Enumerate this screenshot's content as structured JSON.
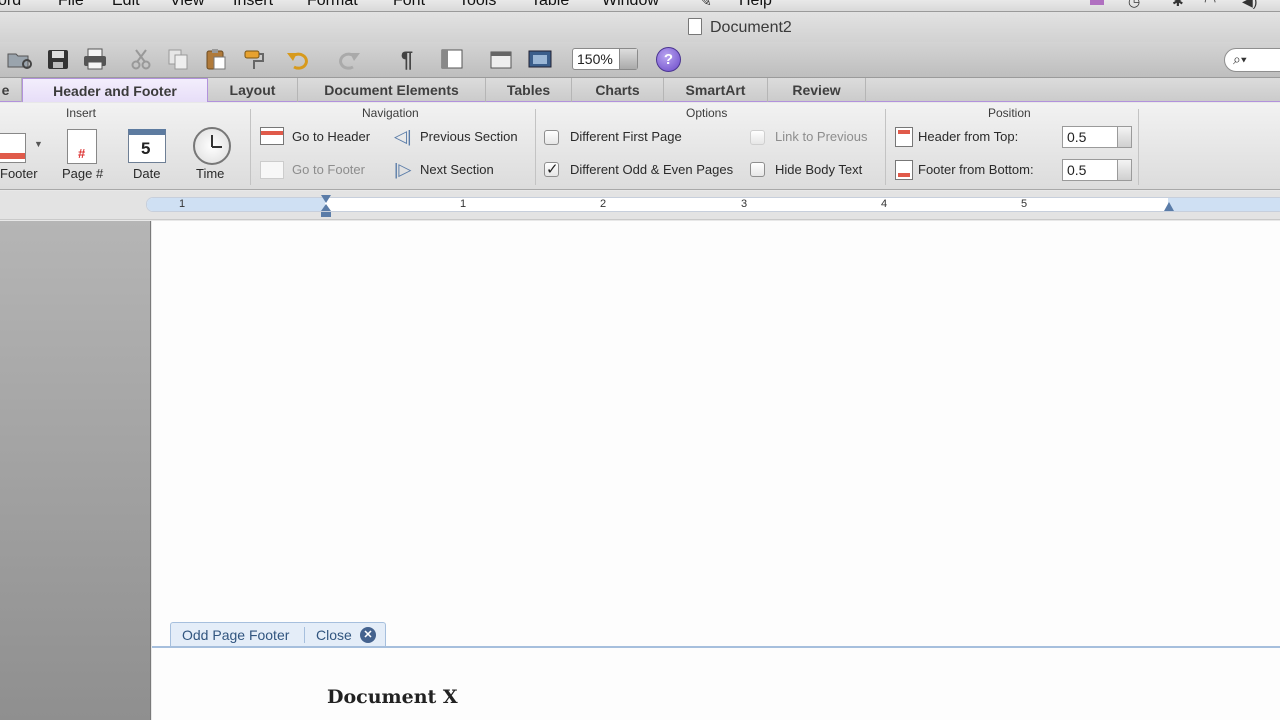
{
  "menubar": {
    "items": [
      "ord",
      "File",
      "Edit",
      "View",
      "Insert",
      "Format",
      "Font",
      "Tools",
      "Table",
      "Window",
      "Help"
    ]
  },
  "window": {
    "title": "Document2"
  },
  "toolbar": {
    "zoom": "150%",
    "help": "?"
  },
  "tabs": [
    "e",
    "Header and Footer",
    "Layout",
    "Document Elements",
    "Tables",
    "Charts",
    "SmartArt",
    "Review"
  ],
  "ribbon": {
    "insert": {
      "title": "Insert",
      "footer": "Footer",
      "page_num": "Page #",
      "page_num_glyph": "#",
      "date": "Date",
      "date_glyph": "5",
      "time": "Time"
    },
    "navigation": {
      "title": "Navigation",
      "go_to_header": "Go to Header",
      "go_to_footer": "Go to Footer",
      "previous_section": "Previous Section",
      "next_section": "Next Section"
    },
    "options": {
      "title": "Options",
      "different_first_page": "Different First Page",
      "different_odd_even": "Different Odd & Even Pages",
      "link_to_previous": "Link to Previous",
      "hide_body_text": "Hide Body Text",
      "different_odd_even_checked": true
    },
    "position": {
      "title": "Position",
      "header_from_top_label": "Header from Top:",
      "header_from_top_value": "0.5",
      "footer_from_bottom_label": "Footer from Bottom:",
      "footer_from_bottom_value": "0.5"
    }
  },
  "ruler": {
    "labels": [
      "1",
      "1",
      "2",
      "3",
      "4",
      "5"
    ]
  },
  "document": {
    "footer_label": "Odd Page Footer",
    "close_label": "Close",
    "footer_text": "Document X"
  }
}
